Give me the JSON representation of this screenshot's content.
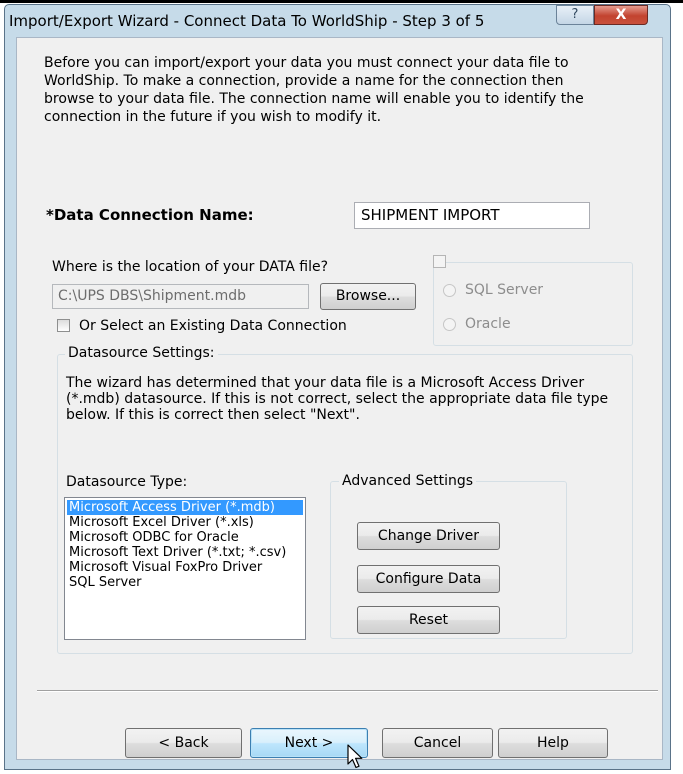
{
  "window": {
    "title": "Import/Export Wizard - Connect Data To WorldShip - Step 3 of 5",
    "help_glyph": "?",
    "close_glyph": "X"
  },
  "intro_text": "Before you can import/export your data you must connect your data file to WorldShip. To make a connection, provide a name for the connection then browse to your data file. The connection name will enable you to identify the connection in the future if you wish to modify it.",
  "connection": {
    "label": "*Data Connection Name:",
    "value": "SHIPMENT IMPORT"
  },
  "location": {
    "label": "Where is the location of your DATA file?",
    "path_value": "C:\\UPS DBS\\Shipment.mdb",
    "browse_label": "Browse...",
    "existing_label": "Or Select an Existing Data Connection",
    "existing_checked": false
  },
  "db_options": {
    "checked": false,
    "enabled": false,
    "radios": [
      "SQL Server",
      "Oracle"
    ]
  },
  "datasource": {
    "legend": "Datasource Settings:",
    "description": "The wizard has determined that your data file is a Microsoft Access Driver (*.mdb) datasource. If this is not correct, select the appropriate data file type below. If this is correct then select \"Next\".",
    "type_label": "Datasource Type:",
    "types": [
      "Microsoft Access Driver (*.mdb)",
      "Microsoft Excel Driver (*.xls)",
      "Microsoft ODBC for Oracle",
      "Microsoft Text Driver (*.txt; *.csv)",
      "Microsoft Visual FoxPro Driver",
      "SQL Server"
    ],
    "selected_type": "Microsoft Access Driver (*.mdb)"
  },
  "advanced": {
    "legend": "Advanced Settings",
    "change_driver": "Change Driver",
    "configure_data": "Configure Data",
    "reset": "Reset"
  },
  "nav": {
    "back": "< Back",
    "next": "Next >",
    "cancel": "Cancel",
    "help": "Help"
  }
}
